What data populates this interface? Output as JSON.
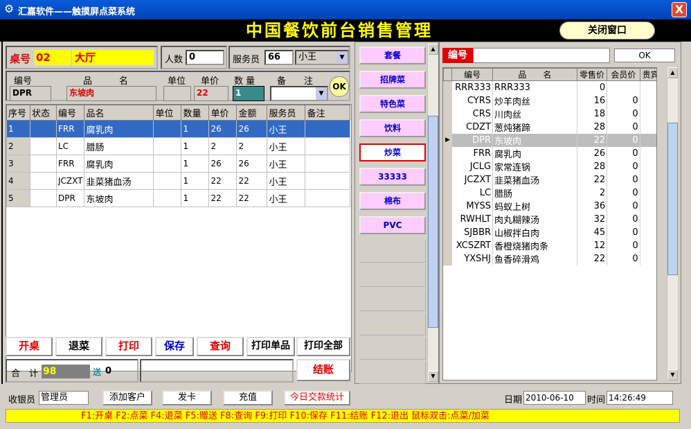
{
  "window": {
    "title": "汇嘉软件——触摸屏点菜系统",
    "close_glyph": "X"
  },
  "banner": "中国餐饮前台销售管理",
  "close_window_label": "关闭窗口",
  "order": {
    "table_label": "桌号",
    "table_no": "02",
    "hall": "大厅",
    "people_label": "人数",
    "people": "0",
    "server_label": "服务员",
    "server_code": "66",
    "server_name": "小王"
  },
  "entry": {
    "code_label": "编号",
    "name_label": "品　　　名",
    "unit_label": "单位",
    "price_label": "单价",
    "qty_label": "数 量",
    "remark_label": "备　　注",
    "code": "DPR",
    "name": "东坡肉",
    "unit": "",
    "price": "22",
    "qty": "1",
    "ok_label": "OK"
  },
  "order_table": {
    "headers": [
      "序号",
      "状态",
      "编号",
      "品名",
      "单位",
      "数量",
      "单价",
      "金额",
      "服务员",
      "备注"
    ],
    "rows": [
      [
        "1",
        "",
        "FRR",
        "腐乳肉",
        "",
        "1",
        "26",
        "26",
        "小王",
        ""
      ],
      [
        "2",
        "",
        "LC",
        "腊肠",
        "",
        "1",
        "2",
        "2",
        "小王",
        ""
      ],
      [
        "3",
        "",
        "FRR",
        "腐乳肉",
        "",
        "1",
        "26",
        "26",
        "小王",
        ""
      ],
      [
        "4",
        "",
        "JCZXT",
        "韭菜猪血汤",
        "",
        "1",
        "22",
        "22",
        "小王",
        ""
      ],
      [
        "5",
        "",
        "DPR",
        "东坡肉",
        "",
        "1",
        "22",
        "22",
        "小王",
        ""
      ]
    ]
  },
  "actions": {
    "open": "开桌",
    "return": "退菜",
    "print": "打印",
    "save": "保存",
    "query": "查询",
    "print_single": "打印单品",
    "print_all": "打印全部",
    "checkout": "结账"
  },
  "total": {
    "label": "合　计",
    "value": "98",
    "gift_label": "送",
    "gift": "0"
  },
  "categories": [
    "套餐",
    "招牌菜",
    "特色菜",
    "饮料",
    "炒菜",
    "33333",
    "棉布",
    "PVC"
  ],
  "active_category": "炒菜",
  "search": {
    "label": "编号",
    "value": "",
    "ok_label": "OK"
  },
  "menu_table": {
    "headers": [
      "编号",
      "品　　名",
      "零售价",
      "会员价",
      "贵宾价"
    ],
    "rows": [
      [
        "RRR333",
        "RRR333",
        "0",
        "",
        ""
      ],
      [
        "CYRS",
        "炒羊肉丝",
        "16",
        "0",
        "0"
      ],
      [
        "CRS",
        "川肉丝",
        "18",
        "0",
        "0"
      ],
      [
        "CDZT",
        "葱炖猪蹄",
        "28",
        "0",
        "0"
      ],
      [
        "DPR",
        "东坡肉",
        "22",
        "0",
        "0"
      ],
      [
        "FRR",
        "腐乳肉",
        "26",
        "0",
        "0"
      ],
      [
        "JCLG",
        "家常连锅",
        "28",
        "0",
        "0"
      ],
      [
        "JCZXT",
        "韭菜猪血汤",
        "22",
        "0",
        "0"
      ],
      [
        "LC",
        "腊肠",
        "2",
        "0",
        "0"
      ],
      [
        "MYSS",
        "蚂蚁上树",
        "36",
        "0",
        "0"
      ],
      [
        "RWHLT",
        "肉丸糊辣汤",
        "32",
        "0",
        "0"
      ],
      [
        "SJBBR",
        "山椒拌白肉",
        "45",
        "0",
        "0"
      ],
      [
        "XCSZRT",
        "香橙烧猪肉条",
        "12",
        "0",
        "0"
      ],
      [
        "YXSHJ",
        "鱼香碎滑鸡",
        "22",
        "0",
        "0"
      ]
    ],
    "current_row": 4
  },
  "footer": {
    "cashier_label": "收银员",
    "cashier": "管理员",
    "add_customer": "添加客户",
    "issue_card": "发卡",
    "recharge": "充值",
    "today_stats": "今日交款统计",
    "date_label": "日期",
    "date": "2010-06-10",
    "time_label": "时间",
    "time": "14:26:49"
  },
  "shortcuts": "F1:开桌 F2:点菜 F4:退菜 F5:赠送 F8:查询 F9:打印 F10:保存 F11:结账 F12:退出  鼠标双击:点菜/加菜",
  "colors": {
    "title_bar": "#0a5bd8",
    "banner_text": "#ffff00",
    "selected_row": "#316ac5",
    "category_bg": "#ffccff",
    "shortcut_bar": "#ffff00"
  }
}
